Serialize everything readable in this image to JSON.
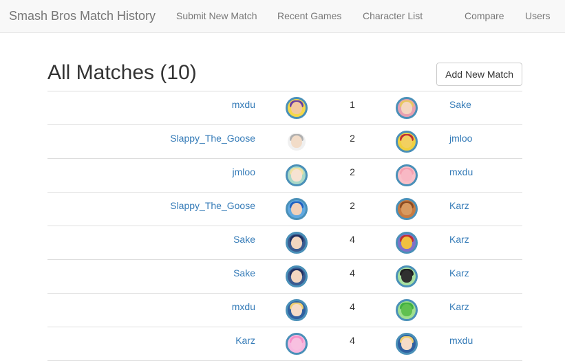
{
  "nav": {
    "brand": "Smash Bros Match History",
    "links": [
      "Submit New Match",
      "Recent Games",
      "Character List",
      "Compare",
      "Users"
    ]
  },
  "page": {
    "title": "All Matches (10)",
    "add_button": "Add New Match"
  },
  "matches": [
    {
      "player1": "mxdu",
      "char1": "wario-icon",
      "stocks": "1",
      "char2": "shulk-icon",
      "player2": "Sake"
    },
    {
      "player1": "Slappy_The_Goose",
      "char1": "robin-icon",
      "stocks": "2",
      "char2": "king-dedede-icon",
      "player2": "jmloo"
    },
    {
      "player1": "jmloo",
      "char1": "rosalina-icon",
      "stocks": "2",
      "char2": "kirby-icon",
      "player2": "mxdu"
    },
    {
      "player1": "Slappy_The_Goose",
      "char1": "mega-man-icon",
      "stocks": "2",
      "char2": "duck-hunt-icon",
      "player2": "Karz"
    },
    {
      "player1": "Sake",
      "char1": "marth-icon",
      "stocks": "4",
      "char2": "captain-falcon-icon",
      "player2": "Karz"
    },
    {
      "player1": "Sake",
      "char1": "marth-icon",
      "stocks": "4",
      "char2": "mr-game-and-watch-icon",
      "player2": "Karz"
    },
    {
      "player1": "mxdu",
      "char1": "zero-suit-samus-icon",
      "stocks": "4",
      "char2": "yoshi-icon",
      "player2": "Karz"
    },
    {
      "player1": "Karz",
      "char1": "jigglypuff-icon",
      "stocks": "4",
      "char2": "zero-suit-samus-icon",
      "player2": "mxdu"
    }
  ]
}
